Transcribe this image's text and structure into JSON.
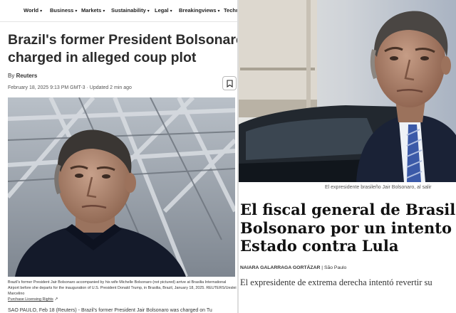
{
  "reuters": {
    "nav": [
      {
        "label": "World"
      },
      {
        "label": "Business"
      },
      {
        "label": "Markets"
      },
      {
        "label": "Sustainability"
      },
      {
        "label": "Legal"
      },
      {
        "label": "Breakingviews"
      },
      {
        "label": "Techn"
      }
    ],
    "headline_line1": "Brazil's former President Bolsonaro",
    "headline_line2": "charged in alleged coup plot",
    "byline_prefix": "By",
    "byline_author": "Reuters",
    "dateline": "February 18, 2025 9:13 PM GMT-3 · Updated 2 min ago",
    "caption": "Brazil's former President Jair Bolsonaro accompanied by his wife Michelle Bolsonaro (not pictured) arrive at Brasilia International Airport before she departs for the inauguration of U.S. President Donald Trump, in Brasilia, Brazil, January 18, 2025. REUTERS/Ueslei Marcelino",
    "caption_link": "Purchase Licensing Rights",
    "body_start": "SAO PAULO, Feb 18 (Reuters) - Brazil's former President Jair Bolsonaro was charged on Tu"
  },
  "elpais": {
    "photo_caption": "El expresidente brasileño Jair Bolsonaro, al salir",
    "headline_line1": "El fiscal general de Brasil d",
    "headline_line2": "Bolsonaro por un intento d",
    "headline_line3": "Estado contra Lula",
    "author": "NAIARA GALARRAGA GORTÁZAR",
    "location": "| São Paulo",
    "subhead": "El expresidente de extrema derecha intentó revertir su"
  }
}
